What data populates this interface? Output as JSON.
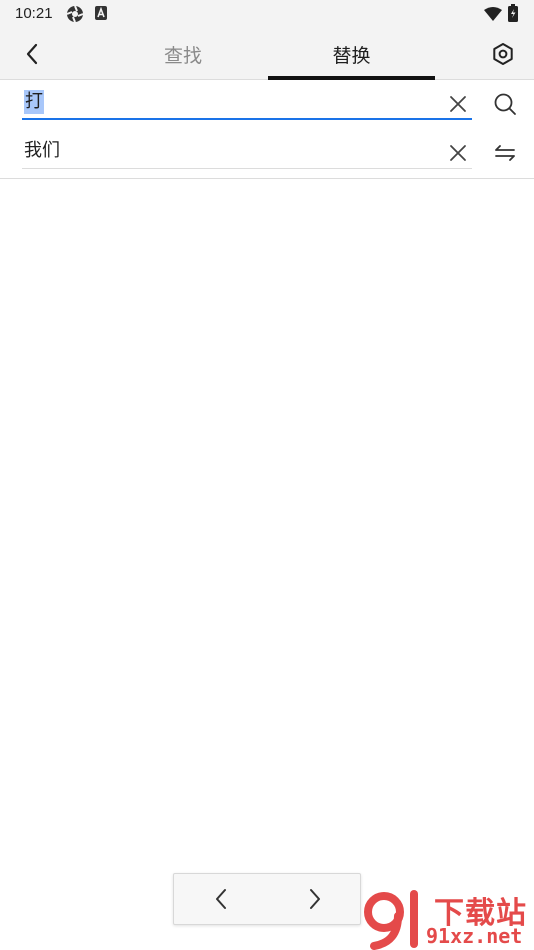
{
  "status_bar": {
    "time": "10:21",
    "icons": [
      "aperture-icon",
      "a-badge-icon",
      "wifi-icon",
      "battery-icon"
    ]
  },
  "header": {
    "back_icon": "chevron-left-icon",
    "tabs": [
      {
        "label": "查找",
        "active": false
      },
      {
        "label": "替换",
        "active": true
      }
    ],
    "settings_icon": "hexagon-settings-icon"
  },
  "find_row": {
    "value": "打",
    "clear_icon": "close-icon",
    "action_icon": "search-icon"
  },
  "replace_row": {
    "value": "我们",
    "clear_icon": "close-icon",
    "action_icon": "swap-icon"
  },
  "nav": {
    "prev_icon": "chevron-left-icon",
    "next_icon": "chevron-right-icon"
  },
  "watermark": {
    "line1": "下载站",
    "line2": "91xz.net"
  },
  "colors": {
    "accent": "#1a73e8",
    "selection": "#a8c7fa",
    "header_bg": "#f3f3f3",
    "watermark": "#e44a4a"
  }
}
